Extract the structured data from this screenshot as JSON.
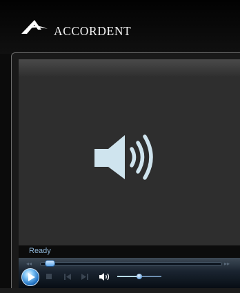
{
  "brand": {
    "name": "ACCORDENT",
    "logo": "accordent-a-logo-icon"
  },
  "player": {
    "status": "Ready",
    "media_icon": "speaker-volume-icon",
    "seek_position": 0.03,
    "volume_level": 0.5,
    "rewind_label": "◂◂",
    "forward_label": "▸▸",
    "controls": [
      "play-icon",
      "stop-icon",
      "previous-icon",
      "next-icon",
      "volume-icon"
    ]
  },
  "colors": {
    "accent": "#5ca5e8",
    "status_text": "#8fb6d8",
    "speaker": "#cfe4ee"
  }
}
